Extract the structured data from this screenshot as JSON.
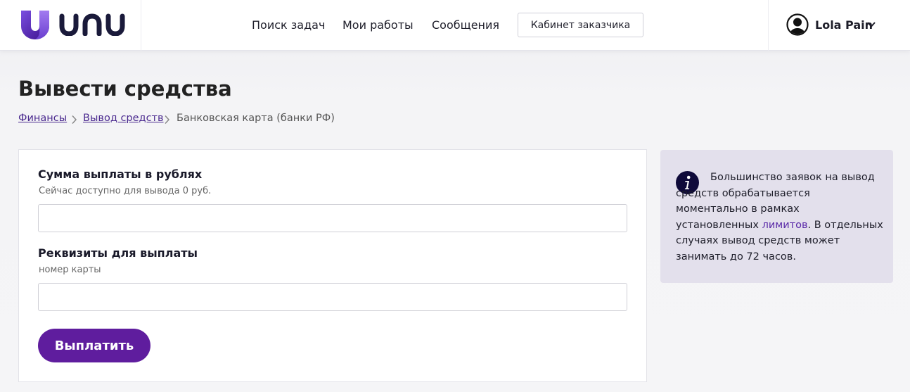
{
  "header": {
    "logo_text": "unu",
    "nav": [
      {
        "label": "Поиск задач"
      },
      {
        "label": "Мои работы"
      },
      {
        "label": "Сообщения"
      }
    ],
    "customer_cabinet_button": "Кабинет заказчика",
    "user_name": "Lola Pain"
  },
  "page": {
    "title": "Вывести средства",
    "breadcrumb": {
      "finances": "Финансы",
      "withdrawal": "Вывод средств",
      "current": "Банковская карта (банки РФ)"
    }
  },
  "form": {
    "amount_label": "Сумма выплаты в рублях",
    "amount_hint": "Сейчас доступно для вывода 0 руб.",
    "amount_value": "",
    "details_label": "Реквизиты для выплаты",
    "details_hint": "номер карты",
    "details_value": "",
    "submit_label": "Выплатить"
  },
  "info": {
    "text_before": "Большинство заявок на вывод средств обрабатывается моментально в рамках установленных ",
    "link_text": "лимитов",
    "text_after": ". В отдельных случаях вывод средств может занимать до 72 часов."
  },
  "colors": {
    "brand_purple": "#5f1d9e",
    "link_purple": "#4b2a8f",
    "info_bg": "#e3e0ec"
  }
}
